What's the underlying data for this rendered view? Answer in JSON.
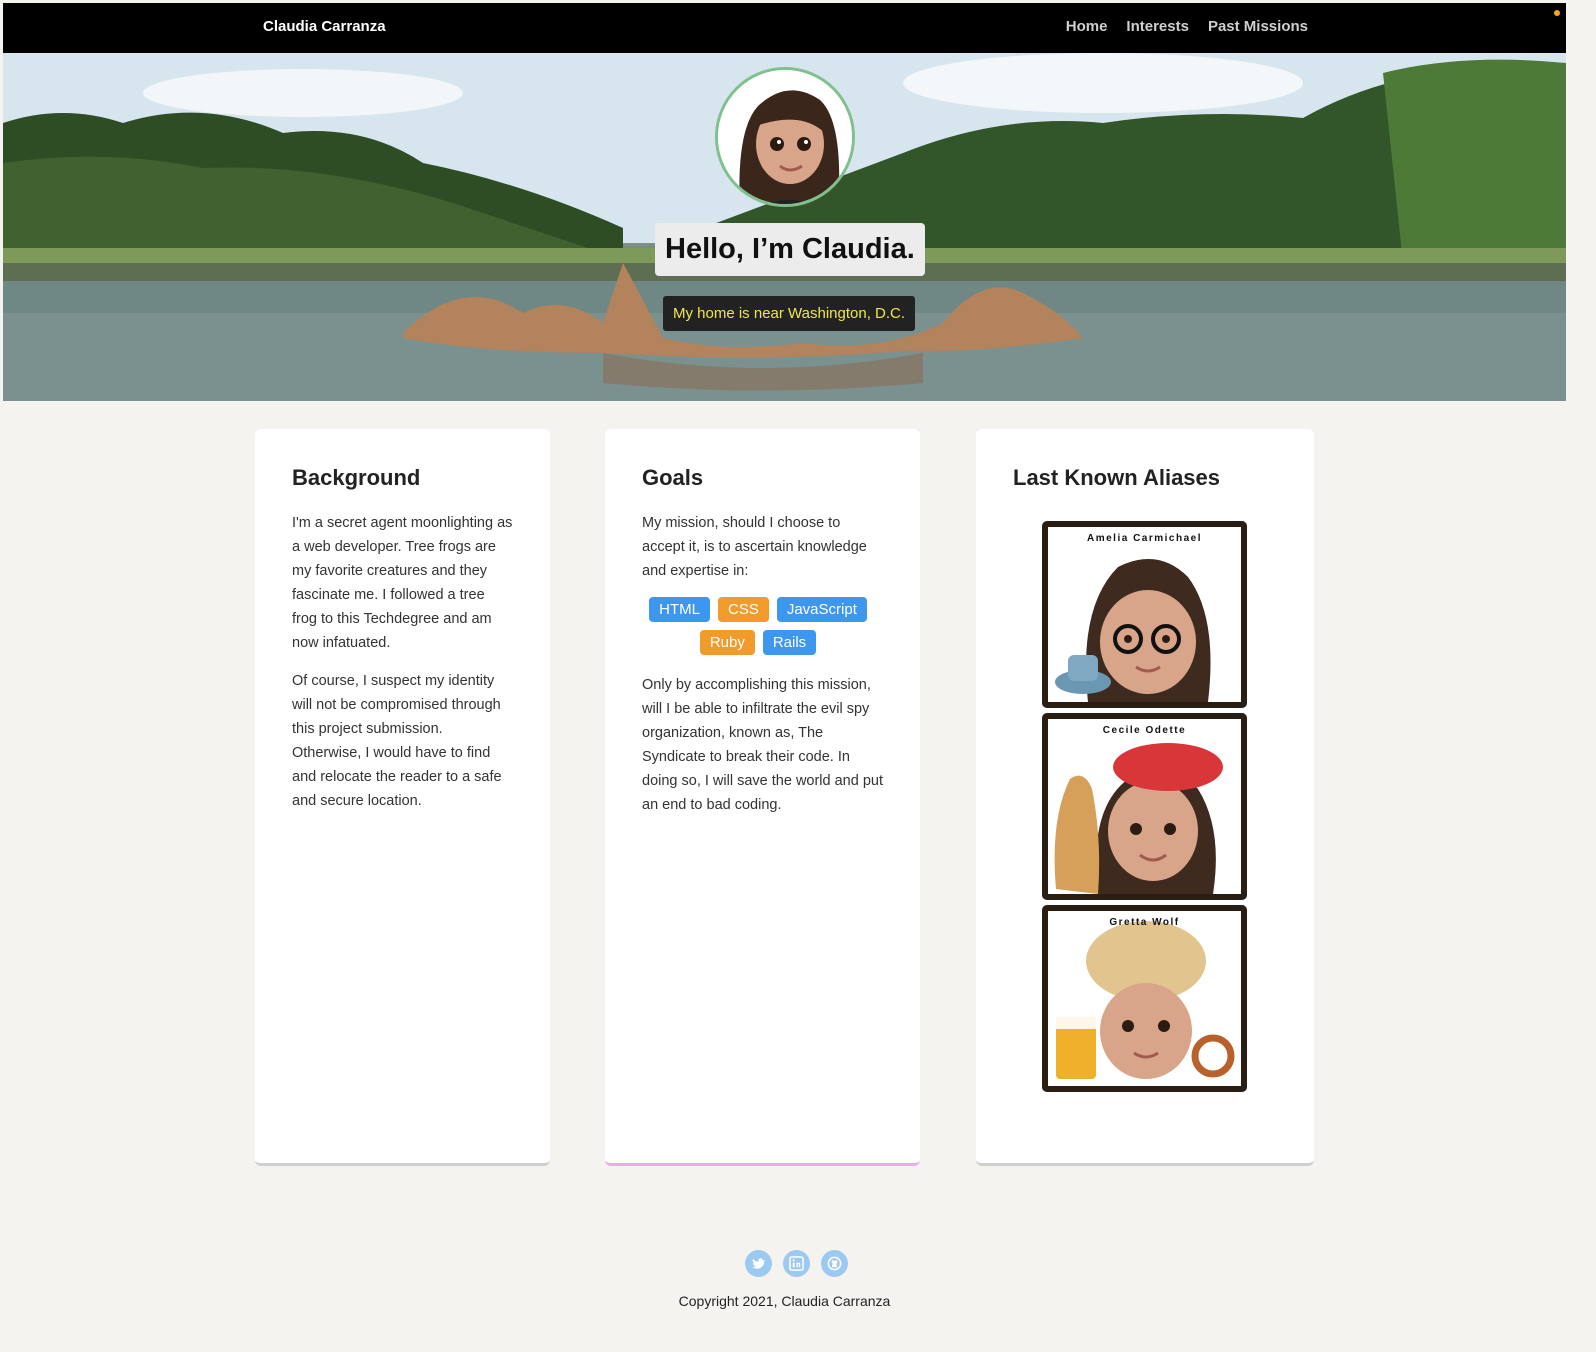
{
  "nav": {
    "brand": "Claudia Carranza",
    "links": [
      "Home",
      "Interests",
      "Past Missions"
    ]
  },
  "hero": {
    "title": "Hello, I’m Claudia.",
    "subtitle": "My home is near Washington, D.C."
  },
  "cards": {
    "background": {
      "heading": "Background",
      "paragraphs": [
        "I'm a secret agent moonlighting as a web developer. Tree frogs are my favorite creatures and they fascinate me. I followed a tree frog to this Techdegree and am now infatuated.",
        "Of course, I suspect my identity will not be compromised through this project submission. Otherwise, I would have to find and relocate the reader to a safe and secure location."
      ]
    },
    "goals": {
      "heading": "Goals",
      "intro": "My mission, should I choose to accept it, is to ascertain knowledge and expertise in:",
      "tags": [
        "HTML",
        "CSS",
        "JavaScript",
        "Ruby",
        "Rails"
      ],
      "outro": "Only by accomplishing this mission, will I be able to infiltrate the evil spy organization, known as, The Syndicate to break their code. In doing so, I will save the world and put an end to bad coding."
    },
    "aliases": {
      "heading": "Last Known Aliases",
      "names": [
        "Amelia Carmichael",
        "Cecile Odette",
        "Gretta Wolf"
      ]
    }
  },
  "footer": {
    "social_icons": [
      "twitter-icon",
      "linkedin-icon",
      "github-icon"
    ],
    "copyright": "Copyright 2021, Claudia Carranza"
  },
  "colors": {
    "nav_bg": "#000000",
    "page_bg": "#f4f3ef",
    "tag_blue": "#3e97ee",
    "tag_orange": "#f19b2b",
    "subtitle_text": "#f1e552",
    "goals_border": "#f0a8f5"
  }
}
